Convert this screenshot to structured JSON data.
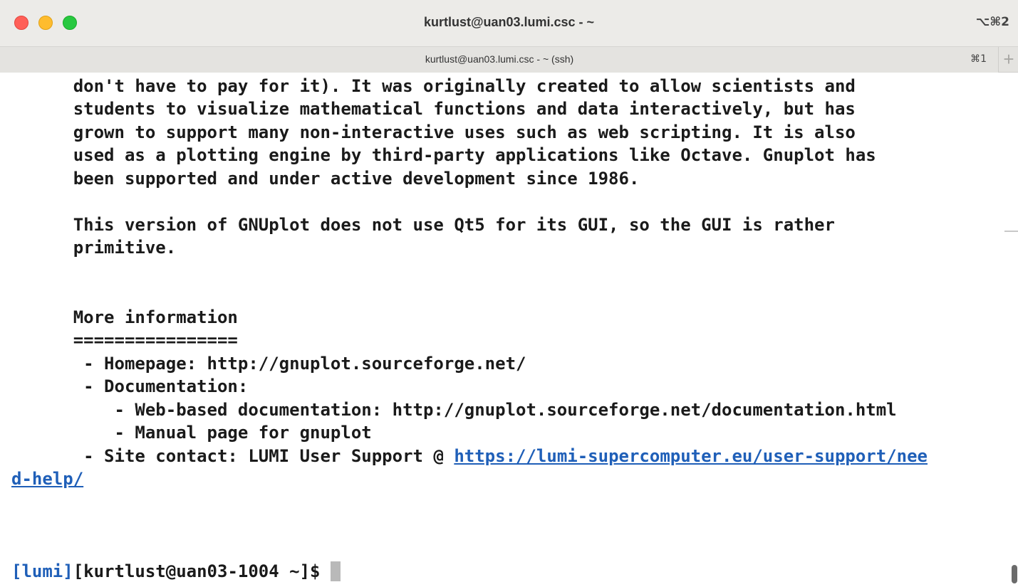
{
  "window": {
    "title": "kurtlust@uan03.lumi.csc - ~",
    "shortcut": "⌥⌘2"
  },
  "tab": {
    "title": "kurtlust@uan03.lumi.csc - ~ (ssh)",
    "shortcut": "⌘1",
    "new_tab_glyph": "+"
  },
  "terminal": {
    "lines": [
      "      don't have to pay for it). It was originally created to allow scientists and",
      "      students to visualize mathematical functions and data interactively, but has",
      "      grown to support many non-interactive uses such as web scripting. It is also",
      "      used as a plotting engine by third-party applications like Octave. Gnuplot has",
      "      been supported and under active development since 1986.",
      "",
      "      This version of GNUplot does not use Qt5 for its GUI, so the GUI is rather",
      "      primitive.",
      "",
      "",
      "      More information",
      "      ================",
      "       - Homepage: http://gnuplot.sourceforge.net/",
      "       - Documentation:",
      "          - Web-based documentation: http://gnuplot.sourceforge.net/documentation.html",
      "          - Manual page for gnuplot"
    ],
    "site_contact_prefix": "       - Site contact: LUMI User Support @ ",
    "site_contact_link_part1": "https://lumi-supercomputer.eu/user-support/nee",
    "site_contact_link_part2": "d-help/",
    "prompt_tag": "[lumi]",
    "prompt_rest": "[kurtlust@uan03-1004 ~]$ "
  },
  "colors": {
    "link": "#1f5fb8",
    "close": "#ff5f57",
    "minimize": "#febc2e",
    "maximize": "#28c840"
  }
}
